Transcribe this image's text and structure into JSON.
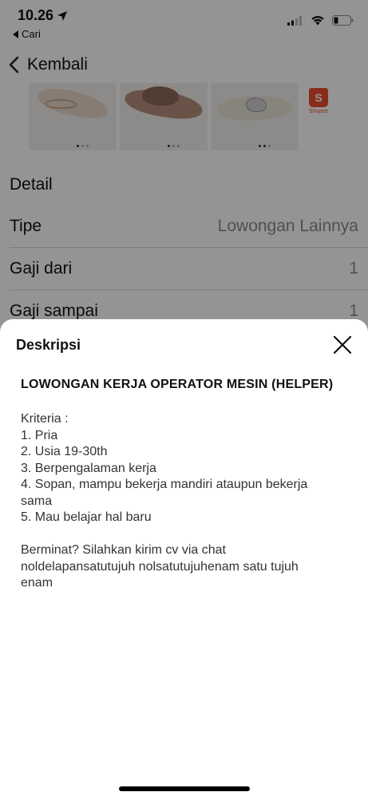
{
  "status_bar": {
    "time": "10.26",
    "back_app": "Cari"
  },
  "nav": {
    "back_label": "Kembali"
  },
  "thumbnails": {
    "shop_badge": "Shopee"
  },
  "detail": {
    "heading": "Detail",
    "rows": [
      {
        "label": "Tipe",
        "value": "Lowongan Lainnya"
      },
      {
        "label": "Gaji dari",
        "value": "1"
      },
      {
        "label": "Gaji sampai",
        "value": "1"
      }
    ]
  },
  "sheet": {
    "title": "Deskripsi",
    "job_title": "LOWONGAN KERJA OPERATOR MESIN (HELPER)",
    "description": [
      "Kriteria :",
      "1. Pria",
      "2. Usia 19-30th",
      "3. Berpengalaman kerja",
      "4. Sopan, mampu bekerja mandiri ataupun bekerja",
      "sama",
      "5. Mau belajar hal baru",
      "",
      "Berminat? Silahkan kirim cv via chat",
      "noldelapansatutujuh nolsatutujuhenam satu tujuh",
      "enam"
    ]
  }
}
